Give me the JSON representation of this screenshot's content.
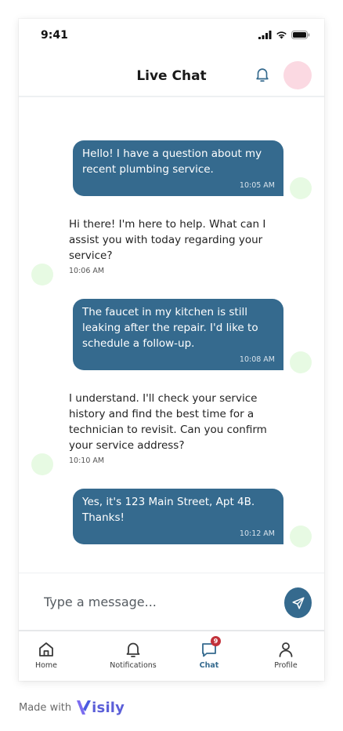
{
  "status_bar": {
    "time": "9:41"
  },
  "header": {
    "title": "Live Chat"
  },
  "messages": [
    {
      "sender": "user",
      "text": "Hello! I have a question about my recent plumbing service.",
      "time": "10:05 AM"
    },
    {
      "sender": "agent",
      "text": "Hi there! I'm here to help. What can I assist you with today regarding your service?",
      "time": "10:06 AM"
    },
    {
      "sender": "user",
      "text": "The faucet in my kitchen is still leaking after the repair. I'd like to schedule a follow-up.",
      "time": "10:08 AM"
    },
    {
      "sender": "agent",
      "text": "I understand. I'll check your service history and find the best time for a technician to revisit. Can you confirm your service address?",
      "time": "10:10 AM"
    },
    {
      "sender": "user",
      "text": "Yes, it's 123 Main Street, Apt 4B. Thanks!",
      "time": "10:12 AM"
    }
  ],
  "composer": {
    "placeholder": "Type a message..."
  },
  "nav": {
    "items": [
      {
        "label": "Home",
        "icon": "home-icon",
        "active": false
      },
      {
        "label": "Notifications",
        "icon": "bell-icon",
        "active": false
      },
      {
        "label": "Chat",
        "icon": "chat-icon",
        "active": true,
        "badge": "9"
      },
      {
        "label": "Profile",
        "icon": "person-icon",
        "active": false
      }
    ]
  },
  "footer": {
    "made_with": "Made with",
    "brand_rest": "isily"
  },
  "colors": {
    "accent": "#356a8e",
    "badge": "#c2313a",
    "header_avatar": "#fbd9e2",
    "message_avatar": "#e7fae3",
    "brand": "#5b5fd8"
  }
}
